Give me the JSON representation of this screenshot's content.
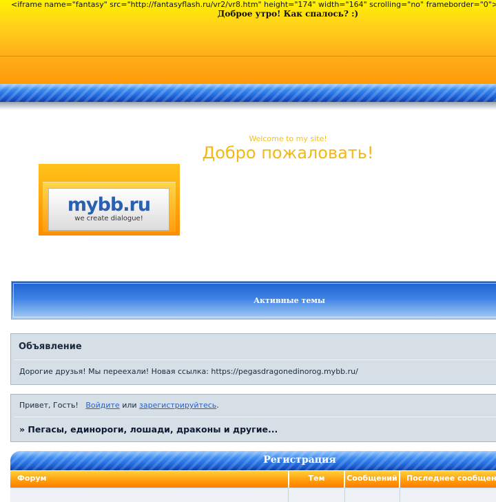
{
  "header": {
    "iframe_code": "<iframe name=\"fantasy\" src=\"http://fantasyflash.ru/vr2/vr8.htm\" height=\"174\" width=\"164\" scrolling=\"no\" frameborder=\"0\">",
    "greeting": "Доброе утро! Как спалось? :)"
  },
  "welcome": {
    "subtitle": "Welcome to my site!",
    "title": "Добро пожаловать!"
  },
  "logo": {
    "text": "mybb.ru",
    "slogan": "we create dialogue!"
  },
  "active_topics": {
    "title": "Активные темы"
  },
  "announcement": {
    "title": "Объявление",
    "text": "Дорогие друзья! Мы переехали! Новая ссылка: https://pegasdragonedinorog.mybb.ru/"
  },
  "guest": {
    "greeting_prefix": "Привет, Гость!",
    "login_link": "Войдите",
    "or_text": "или",
    "register_link": "зарегистрируйтесь",
    "period": "."
  },
  "board": {
    "title": "» Пегасы, единороги, лошади, драконы и другие..."
  },
  "category": {
    "title": "Регистрация",
    "columns": [
      "Форум",
      "Тем",
      "Сообщений",
      "Последнее сообщение"
    ]
  },
  "colors": {
    "header_yellow": "#fff200",
    "header_orange": "#ff9a0a",
    "blue": "#1c62d8",
    "panel": "#d6dee6",
    "link": "#2a62c8",
    "welcome_gold": "#f2b818"
  }
}
